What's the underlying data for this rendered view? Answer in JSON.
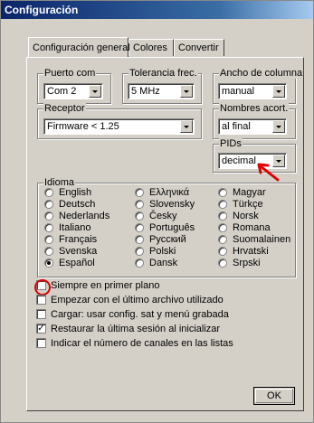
{
  "window": {
    "title": "Configuración"
  },
  "tabs": [
    {
      "label": "Configuración general"
    },
    {
      "label": "Colores"
    },
    {
      "label": "Convertir"
    }
  ],
  "puerto": {
    "label": "Puerto com",
    "value": "Com 2"
  },
  "tolerancia": {
    "label": "Tolerancia frec.",
    "value": "5 MHz"
  },
  "ancho": {
    "label": "Ancho de columna",
    "value": "manual"
  },
  "receptor": {
    "label": "Receptor",
    "value": "Firmware < 1.25"
  },
  "nombres": {
    "label": "Nombres acort.",
    "value": "al final"
  },
  "pids": {
    "label": "PIDs",
    "value": "decimal"
  },
  "idioma": {
    "label": "Idioma",
    "selected": "Español",
    "col1": [
      "English",
      "Deutsch",
      "Nederlands",
      "Italiano",
      "Français",
      "Svenska",
      "Español"
    ],
    "col2": [
      "Ελληνικά",
      "Slovensky",
      "Česky",
      "Português",
      "Русский",
      "Polski",
      "Dansk"
    ],
    "col3": [
      "Magyar",
      "Türkçe",
      "Norsk",
      "Romana",
      "Suomalainen",
      "Hrvatski",
      "Srpski"
    ]
  },
  "options": [
    {
      "label": "Siempre en primer plano",
      "checked": false,
      "highlighted": true
    },
    {
      "label": "Empezar con el último archivo utilizado",
      "checked": false
    },
    {
      "label": "Cargar: usar config. sat y menú grabada",
      "checked": false
    },
    {
      "label": "Restaurar la última sesión al inicializar",
      "checked": true
    },
    {
      "label": "Indicar el número de canales en las listas",
      "checked": false
    }
  ],
  "ok_button": {
    "label": "OK"
  },
  "colors": {
    "highlight": "#e00000",
    "titlebar": "#0a246a"
  }
}
